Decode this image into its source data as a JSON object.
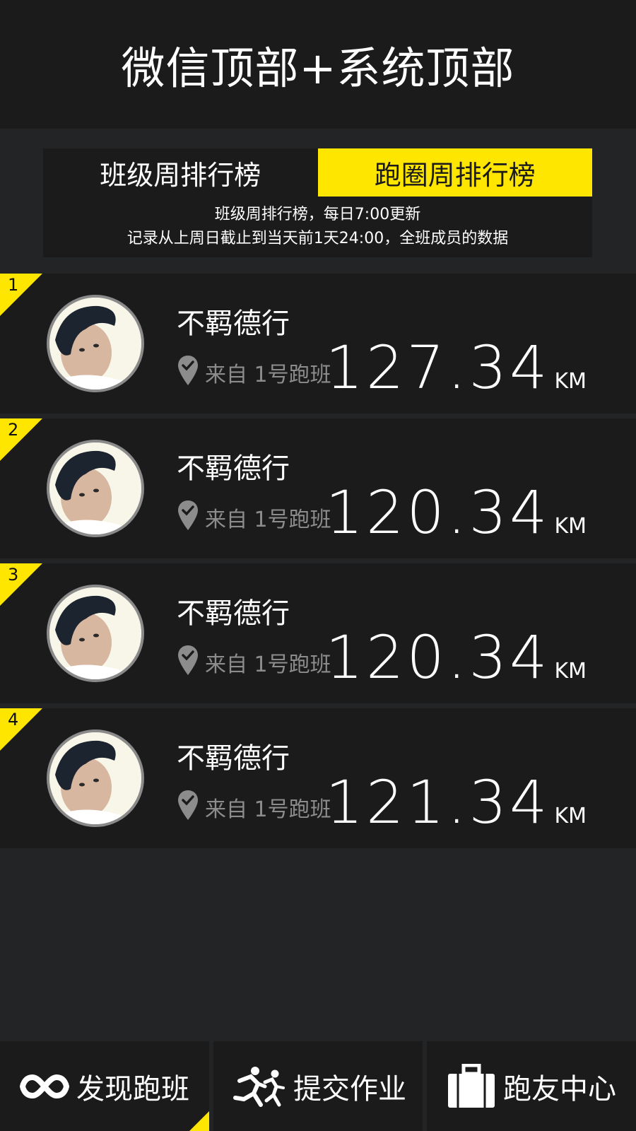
{
  "header": {
    "title": "微信顶部+系统顶部"
  },
  "tabs": [
    {
      "label": "班级周排行榜",
      "active": false
    },
    {
      "label": "跑圈周排行榜",
      "active": true
    }
  ],
  "notice": {
    "line1": "班级周排行榜，每日7:00更新",
    "line2": "记录从上周日截止到当天前1天24:00，全班成员的数据"
  },
  "ranking": [
    {
      "rank": "1",
      "name": "不羁德行",
      "from": "来自 1号跑班",
      "distance": "127.34",
      "unit": "KM"
    },
    {
      "rank": "2",
      "name": "不羁德行",
      "from": "来自 1号跑班",
      "distance": "120.34",
      "unit": "KM"
    },
    {
      "rank": "3",
      "name": "不羁德行",
      "from": "来自 1号跑班",
      "distance": "120.34",
      "unit": "KM"
    },
    {
      "rank": "4",
      "name": "不羁德行",
      "from": "来自 1号跑班",
      "distance": "121.34",
      "unit": "KM"
    }
  ],
  "bottom_nav": [
    {
      "label": "发现跑班",
      "icon": "infinity-icon",
      "selected": true
    },
    {
      "label": "提交作业",
      "icon": "runners-icon",
      "selected": false
    },
    {
      "label": "跑友中心",
      "icon": "briefcase-icon",
      "selected": false
    }
  ],
  "colors": {
    "accent": "#ffe600",
    "panel": "#1b1b1b",
    "background": "#232426",
    "muted": "#8c8c8c"
  }
}
